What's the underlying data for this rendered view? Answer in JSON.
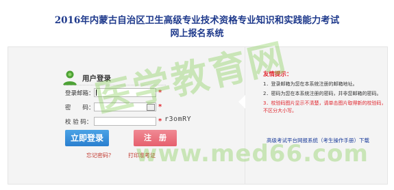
{
  "header": {
    "line1": "2016年内蒙古自治区卫生高级专业技术资格专业知识和实践能力考试",
    "line2": "网上报名系统"
  },
  "login": {
    "title": "用户登录",
    "email_label": "登录邮箱：",
    "password_label": "密　　码：",
    "captcha_label": "校 验 码：",
    "required_mark": "*",
    "captcha_code": "r3omRY",
    "login_button": "立即登录",
    "register_button": "注　册",
    "forgot_password": "忘记密码？",
    "print_ticket": "打印准考证"
  },
  "tips": {
    "title": "友情提示：",
    "items": [
      "1．登录邮箱为您在本系统注册的邮箱地址。",
      "2．密码为您在本系统注册的密码，并非您邮箱的密码。",
      "3．校验码图片显示不清楚，请单击图片取得新的校验码，不区分大小写。"
    ],
    "manual_link": "高级考试平台网报系统（考生操作手册）下载"
  },
  "watermark": {
    "text1": "医学教育网",
    "text2": "www.med66.com"
  },
  "colors": {
    "title_blue": "#1f3a8c",
    "login_button": "#3a93dc",
    "register_button": "#ea7480",
    "required_red": "#e0242c",
    "link_blue": "#1a3b9a"
  }
}
